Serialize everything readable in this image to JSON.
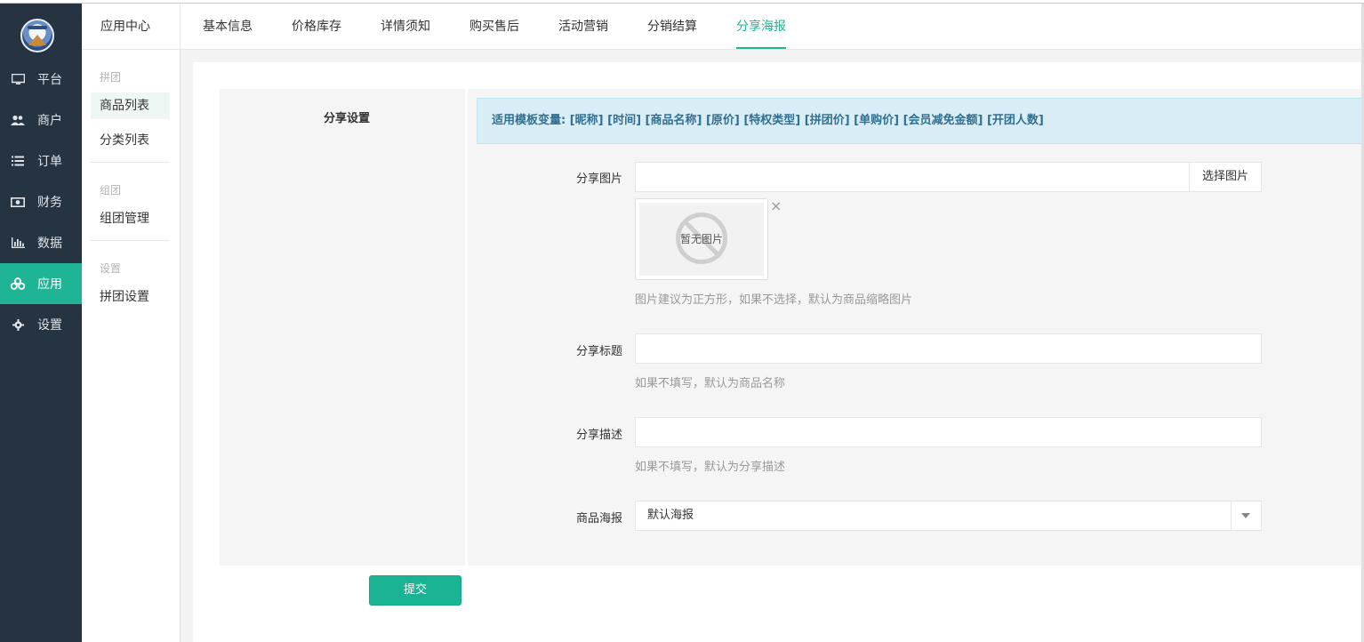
{
  "sidebar": {
    "items": [
      {
        "label": "平台",
        "icon": "monitor-icon"
      },
      {
        "label": "商户",
        "icon": "users-icon"
      },
      {
        "label": "订单",
        "icon": "list-icon"
      },
      {
        "label": "财务",
        "icon": "money-icon"
      },
      {
        "label": "数据",
        "icon": "bar-chart-icon"
      },
      {
        "label": "应用",
        "icon": "apps-icon",
        "active": true
      },
      {
        "label": "设置",
        "icon": "gear-icon"
      }
    ]
  },
  "subnav": {
    "header": "应用中心",
    "groups": [
      {
        "title": "拼团",
        "items": [
          "商品列表",
          "分类列表"
        ]
      },
      {
        "title": "组团",
        "items": [
          "组团管理"
        ]
      },
      {
        "title": "设置",
        "items": [
          "拼团设置"
        ]
      }
    ]
  },
  "tabs": [
    "基本信息",
    "价格库存",
    "详情须知",
    "购买售后",
    "活动营销",
    "分销结算",
    "分享海报"
  ],
  "form": {
    "section_title": "分享设置",
    "alert": "适用模板变量: [昵称] [时间] [商品名称] [原价] [特权类型] [拼团价] [单购价] [会员减免金额] [开团人数]",
    "share_image": {
      "label": "分享图片",
      "value": "",
      "button": "选择图片",
      "placeholder_text": "暂无图片",
      "help": "图片建议为正方形，如果不选择，默认为商品缩略图片"
    },
    "share_title": {
      "label": "分享标题",
      "value": "",
      "help": "如果不填写，默认为商品名称"
    },
    "share_desc": {
      "label": "分享描述",
      "value": "",
      "help": "如果不填写，默认为分享描述"
    },
    "poster": {
      "label": "商品海报",
      "selected": "默认海报"
    },
    "submit": "提交"
  },
  "colors": {
    "accent": "#1ab394",
    "sidebar_bg": "#263340",
    "alert_bg": "#d9edf7",
    "alert_text": "#31708f"
  }
}
